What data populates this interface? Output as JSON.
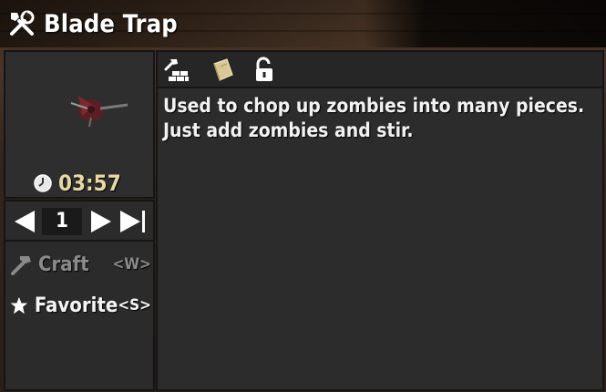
{
  "window": {
    "title": "Blade Trap",
    "title_icon": "tools-icon"
  },
  "preview": {
    "item_icon": "blade-trap-icon",
    "craft_time": "03:57",
    "time_icon": "clock-icon"
  },
  "quantity": {
    "value": "1",
    "decrease_icon": "arrow-left-icon",
    "increase_icon": "arrow-right-icon",
    "max_icon": "arrow-max-icon"
  },
  "actions": {
    "craft": {
      "label": "Craft",
      "key": "<W>",
      "icon": "hammer-icon"
    },
    "favorite": {
      "label": "Favorite",
      "key": "<S>",
      "icon": "star-icon"
    }
  },
  "toolbar": {
    "icons": [
      "build-icon",
      "book-icon",
      "unlock-icon"
    ]
  },
  "description": {
    "text": "Used to chop up zombies into many pieces. Just add zombies and stir."
  },
  "colors": {
    "time": "#e6d7a4",
    "disabled_text": "#8a8a8a",
    "panel": "#2c2c2c"
  }
}
